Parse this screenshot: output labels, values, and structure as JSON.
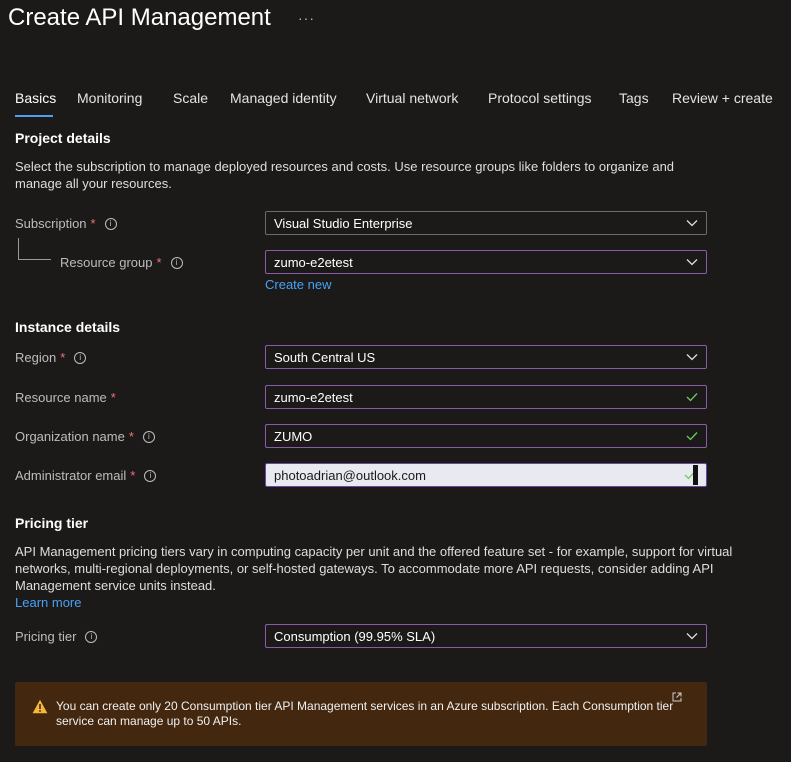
{
  "header": {
    "title": "Create API Management",
    "more_label": "···"
  },
  "tabs": [
    {
      "label": "Basics",
      "active": true
    },
    {
      "label": "Monitoring"
    },
    {
      "label": "Scale"
    },
    {
      "label": "Managed identity"
    },
    {
      "label": "Virtual network"
    },
    {
      "label": "Protocol settings"
    },
    {
      "label": "Tags"
    },
    {
      "label": "Review + create"
    }
  ],
  "project": {
    "title": "Project details",
    "description": "Select the subscription to manage deployed resources and costs. Use resource groups like folders to organize and manage all your resources.",
    "subscription": {
      "label": "Subscription",
      "value": "Visual Studio Enterprise"
    },
    "resource_group": {
      "label": "Resource group",
      "value": "zumo-e2etest",
      "create_new": "Create new"
    }
  },
  "instance": {
    "title": "Instance details",
    "region": {
      "label": "Region",
      "value": "South Central US"
    },
    "resource_name": {
      "label": "Resource name",
      "value": "zumo-e2etest"
    },
    "organization_name": {
      "label": "Organization name",
      "value": "ZUMO"
    },
    "admin_email": {
      "label": "Administrator email",
      "value": "photoadrian@outlook.com"
    }
  },
  "pricing": {
    "title": "Pricing tier",
    "description": "API Management pricing tiers vary in computing capacity per unit and the offered feature set - for example, support for virtual networks, multi-regional deployments, or self-hosted gateways. To accommodate more API requests, consider adding API Management service units instead.",
    "learn_more": "Learn more",
    "tier": {
      "label": "Pricing tier",
      "value": "Consumption (99.95% SLA)"
    }
  },
  "warning": {
    "text": "You can create only 20 Consumption tier API Management services in an Azure subscription. Each Consumption tier service can manage up to 50 APIs.",
    "icon": "warning-icon"
  },
  "required_mark": "*",
  "colors": {
    "accent": "#4aa0f5",
    "required": "#f1707b",
    "valid": "#6ccb5f",
    "warning_bg": "#43280f",
    "warning_icon": "#f7b43e"
  }
}
